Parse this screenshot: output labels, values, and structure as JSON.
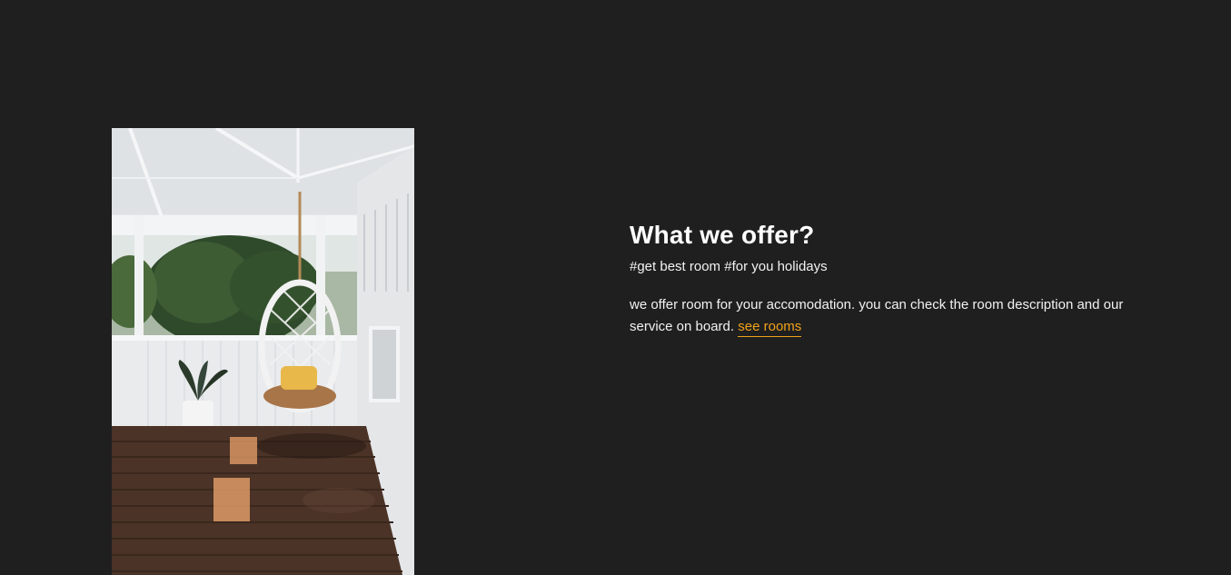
{
  "offer": {
    "title": "What we offer?",
    "tags": "#get best room #for you holidays",
    "description": "we offer room for your accomodation. you can check the room description and our service on board.",
    "link_label": "see rooms"
  },
  "colors": {
    "background": "#1f1f1f",
    "text": "#ffffff",
    "accent": "#f0a21c"
  },
  "image": {
    "subject": "hanging-chair-porch-photo"
  }
}
